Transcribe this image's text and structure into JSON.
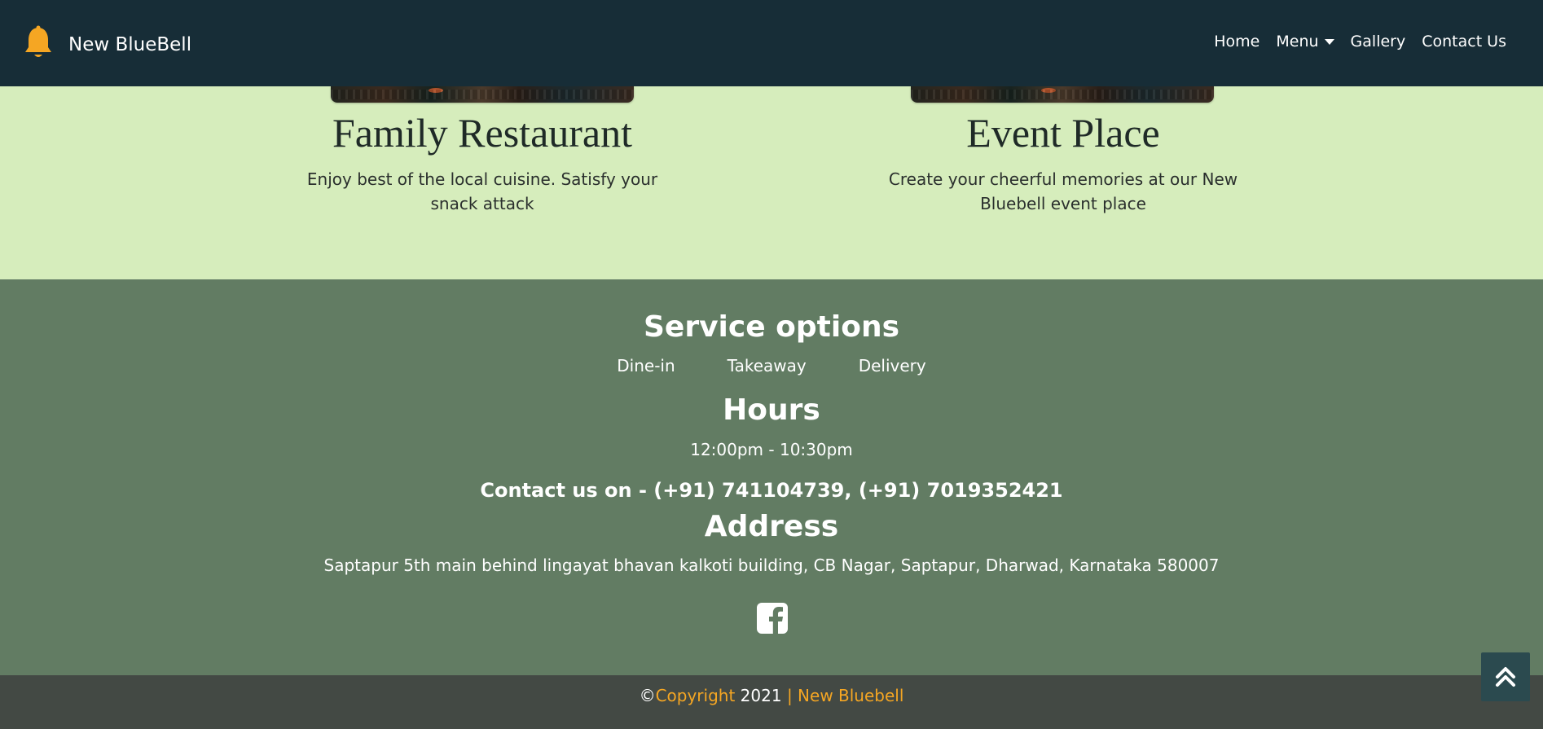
{
  "navbar": {
    "brand_icon": "bell-icon",
    "brand_name": "New BlueBell",
    "links": {
      "home": "Home",
      "menu": "Menu",
      "gallery": "Gallery",
      "contact": "Contact Us"
    },
    "colors": {
      "background": "#172d37",
      "icon": "#f5a623"
    }
  },
  "features": [
    {
      "title": "Family Restaurant",
      "description": "Enjoy best of the local cuisine. Satisfy your snack attack"
    },
    {
      "title": "Event Place",
      "description": "Create your cheerful memories at our New Bluebell event place"
    }
  ],
  "footer": {
    "service_heading": "Service options",
    "service_options": [
      "Dine-in",
      "Takeaway",
      "Delivery"
    ],
    "hours_heading": "Hours",
    "hours": "12:00pm - 10:30pm",
    "contact_line": "Contact us on - (+91) 741104739, (+91) 7019352421",
    "address_heading": "Address",
    "address": "Saptapur 5th main behind lingayat bhavan kalkoti building, CB Nagar, Saptapur, Dharwad, Karnataka 580007",
    "social_icon": "facebook-icon",
    "colors": {
      "background": "#627c63",
      "text": "#ffffff"
    }
  },
  "copyright": {
    "symbol": "©",
    "label": "Copyright",
    "year": " 2021 ",
    "separator": "| ",
    "name": "New Bluebell",
    "colors": {
      "background": "#434944",
      "accent": "#f5a623"
    }
  },
  "back_to_top": {
    "icon": "double-chevron-up-icon"
  },
  "colors": {
    "page_background": "#d6edbc"
  }
}
